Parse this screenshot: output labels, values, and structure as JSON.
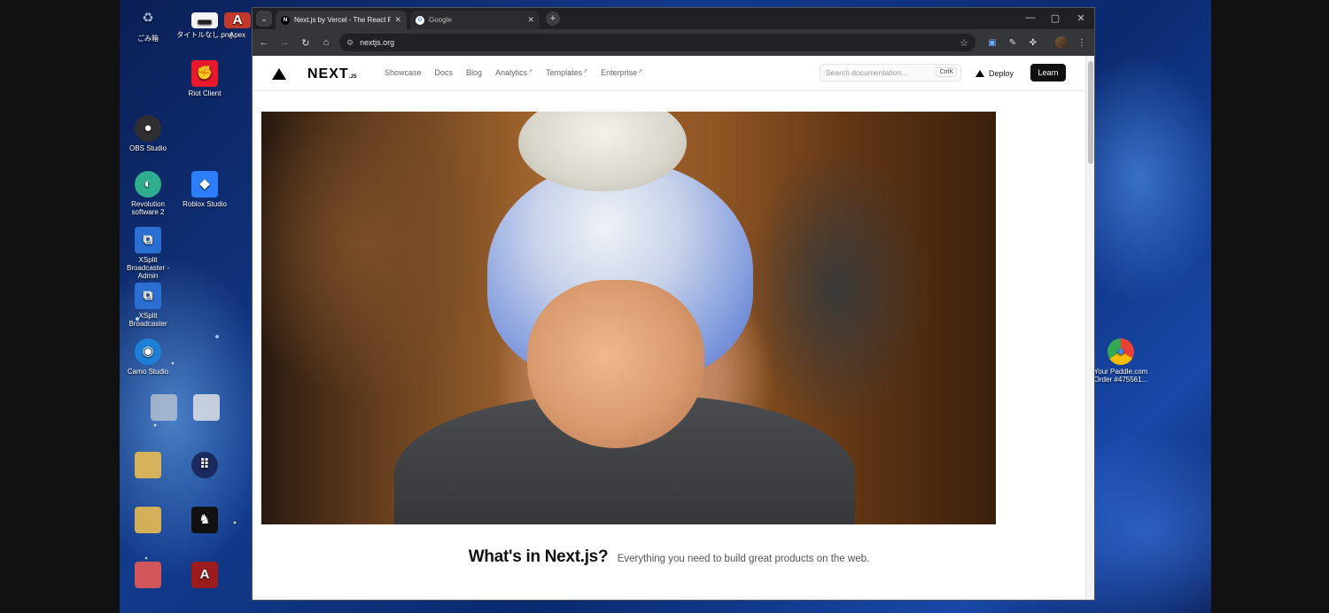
{
  "desktop": {
    "icons": [
      {
        "id": "recycle-bin",
        "label": "ごみ箱",
        "glyph": "♻",
        "color": "#9fb8d8"
      },
      {
        "id": "image-file",
        "label": "タイトルなし.png",
        "glyph": "▬",
        "color": "#eeeeee"
      },
      {
        "id": "apex-file",
        "label": "Apex",
        "glyph": "A",
        "color": "#c0392b"
      },
      {
        "id": "riot-client",
        "label": "Riot Client",
        "glyph": "✊",
        "color": "#e8192c"
      },
      {
        "id": "obs-studio",
        "label": "OBS Studio",
        "glyph": "●",
        "color": "#302e31"
      },
      {
        "id": "revolution",
        "label": "Revolution software 2",
        "glyph": "◐",
        "color": "#2fae8f"
      },
      {
        "id": "roblox-studio",
        "label": "Roblox Studio",
        "glyph": "◆",
        "color": "#2d7ff9"
      },
      {
        "id": "xsplit-admin",
        "label": "XSplit Broadcaster - Admin",
        "glyph": "⧉",
        "color": "#2a6fd1"
      },
      {
        "id": "xsplit",
        "label": "XSplit Broadcaster",
        "glyph": "⧉",
        "color": "#2a6fd1"
      },
      {
        "id": "camo-studio",
        "label": "Camo Studio",
        "glyph": "◉",
        "color": "#1d7fd6"
      },
      {
        "id": "chrome-shortcut",
        "label": "Your Paddle.com Order #475561...",
        "glyph": "◎",
        "color": "#e9e9e9"
      }
    ]
  },
  "browser": {
    "tabs": [
      {
        "title": "Next.js by Vercel - The React Fr...",
        "favicon": "N",
        "active": true
      },
      {
        "title": "Google",
        "favicon": "G",
        "active": false
      }
    ],
    "url": "nextjs.org"
  },
  "site": {
    "brand": "NEXT",
    "brand_suffix": ".JS",
    "nav": [
      {
        "label": "Showcase",
        "external": false
      },
      {
        "label": "Docs",
        "external": false
      },
      {
        "label": "Blog",
        "external": false
      },
      {
        "label": "Analytics",
        "external": true
      },
      {
        "label": "Templates",
        "external": true
      },
      {
        "label": "Enterprise",
        "external": true
      }
    ],
    "search_placeholder": "Search documentation...",
    "search_shortcut": "CtrlK",
    "deploy_label": "Deploy",
    "learn_label": "Learn",
    "section_title": "What's in Next.js?",
    "section_subtitle": "Everything you need to build great products on the web."
  }
}
